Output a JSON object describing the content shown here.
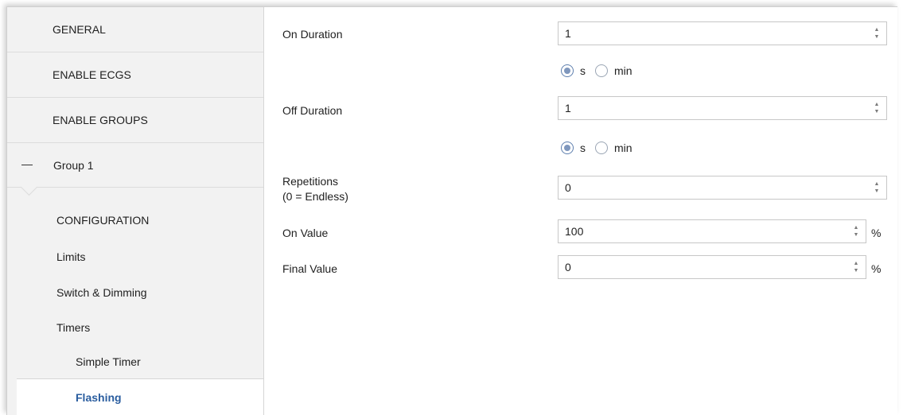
{
  "sidebar": {
    "top_items": [
      {
        "label": "GENERAL"
      },
      {
        "label": "ENABLE ECGS"
      },
      {
        "label": "ENABLE GROUPS"
      }
    ],
    "group": {
      "label": "Group 1"
    },
    "sub_items": [
      {
        "label": "CONFIGURATION"
      },
      {
        "label": "Limits"
      },
      {
        "label": "Switch & Dimming"
      },
      {
        "label": "Timers"
      },
      {
        "label": "Simple Timer"
      }
    ],
    "active_item": {
      "label": "Flashing",
      "color": "#2a5d9f"
    }
  },
  "form": {
    "on_duration": {
      "label": "On Duration",
      "value": "1",
      "unit_options": [
        "s",
        "min"
      ],
      "selected_unit": "s"
    },
    "off_duration": {
      "label": "Off Duration",
      "value": "1",
      "unit_options": [
        "s",
        "min"
      ],
      "selected_unit": "s"
    },
    "repetitions": {
      "label_line1": "Repetitions",
      "label_line2": "(0 = Endless)",
      "value": "0"
    },
    "on_value": {
      "label": "On Value",
      "value": "100",
      "unit": "%"
    },
    "final_value": {
      "label": "Final Value",
      "value": "0",
      "unit": "%"
    }
  },
  "icons": {
    "spinner": "up-down-arrows-icon",
    "collapse": "minus-icon"
  }
}
